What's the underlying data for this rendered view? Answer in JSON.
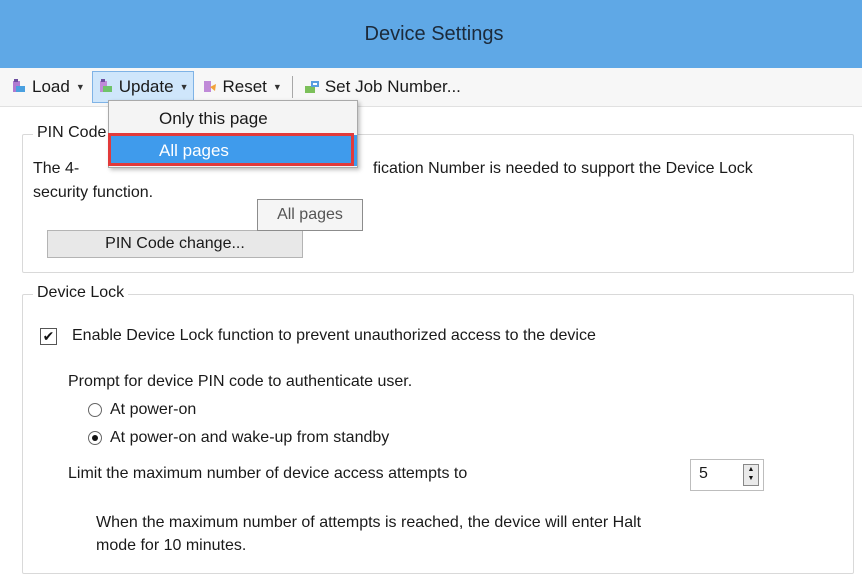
{
  "window": {
    "title": "Device Settings"
  },
  "toolbar": {
    "load_label": "Load",
    "update_label": "Update",
    "reset_label": "Reset",
    "set_job_label": "Set Job Number..."
  },
  "update_menu": {
    "items": [
      "Only this page",
      "All pages"
    ],
    "selected": "All pages"
  },
  "tooltip": {
    "text": "All pages"
  },
  "pin_code": {
    "title": "PIN Code",
    "description_visible_start": "The 4-",
    "description_visible_end": "fication Number is needed to support the Device Lock",
    "description_line2": "security function.",
    "button_label": "PIN Code change..."
  },
  "device_lock": {
    "title": "Device Lock",
    "enable_checkbox_label": "Enable Device Lock function to prevent unauthorized access to the device",
    "enable_checked": true,
    "prompt_text": "Prompt for device PIN code to authenticate user.",
    "radio_options": [
      "At power-on",
      "At power-on and wake-up from standby"
    ],
    "selected_option": "At power-on and wake-up from standby",
    "limit_label": "Limit the maximum number of device access attempts to",
    "limit_value": "5",
    "note_line1": "When the maximum number of attempts is reached, the device will enter Halt",
    "note_line2": "mode for 10 minutes."
  }
}
